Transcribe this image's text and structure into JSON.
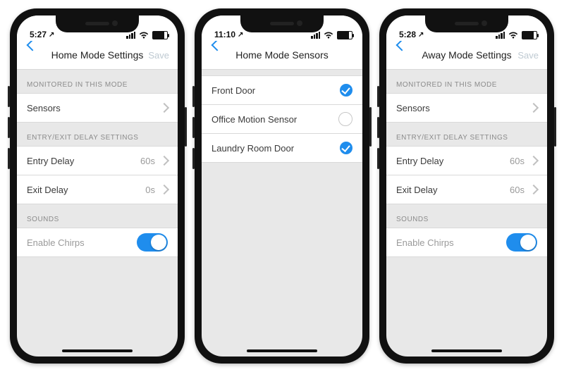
{
  "phones": [
    {
      "status": {
        "time": "5:27",
        "loc_icon": "↗"
      },
      "nav": {
        "title": "Home Mode Settings",
        "save": "Save"
      },
      "sections": {
        "monitored_label": "MONITORED IN THIS MODE",
        "sensors_label": "Sensors",
        "delay_label": "ENTRY/EXIT DELAY SETTINGS",
        "entry_label": "Entry Delay",
        "entry_value": "60s",
        "exit_label": "Exit Delay",
        "exit_value": "0s",
        "sounds_label": "SOUNDS",
        "chirps_label": "Enable Chirps"
      }
    },
    {
      "status": {
        "time": "11:10",
        "loc_icon": "↗"
      },
      "nav": {
        "title": "Home Mode Sensors"
      },
      "sensors": [
        {
          "label": "Front Door",
          "checked": true
        },
        {
          "label": "Office Motion Sensor",
          "checked": false
        },
        {
          "label": "Laundry Room Door",
          "checked": true
        }
      ]
    },
    {
      "status": {
        "time": "5:28",
        "loc_icon": "↗"
      },
      "nav": {
        "title": "Away Mode Settings",
        "save": "Save"
      },
      "sections": {
        "monitored_label": "MONITORED IN THIS MODE",
        "sensors_label": "Sensors",
        "delay_label": "ENTRY/EXIT DELAY SETTINGS",
        "entry_label": "Entry Delay",
        "entry_value": "60s",
        "exit_label": "Exit Delay",
        "exit_value": "60s",
        "sounds_label": "SOUNDS",
        "chirps_label": "Enable Chirps"
      }
    }
  ]
}
